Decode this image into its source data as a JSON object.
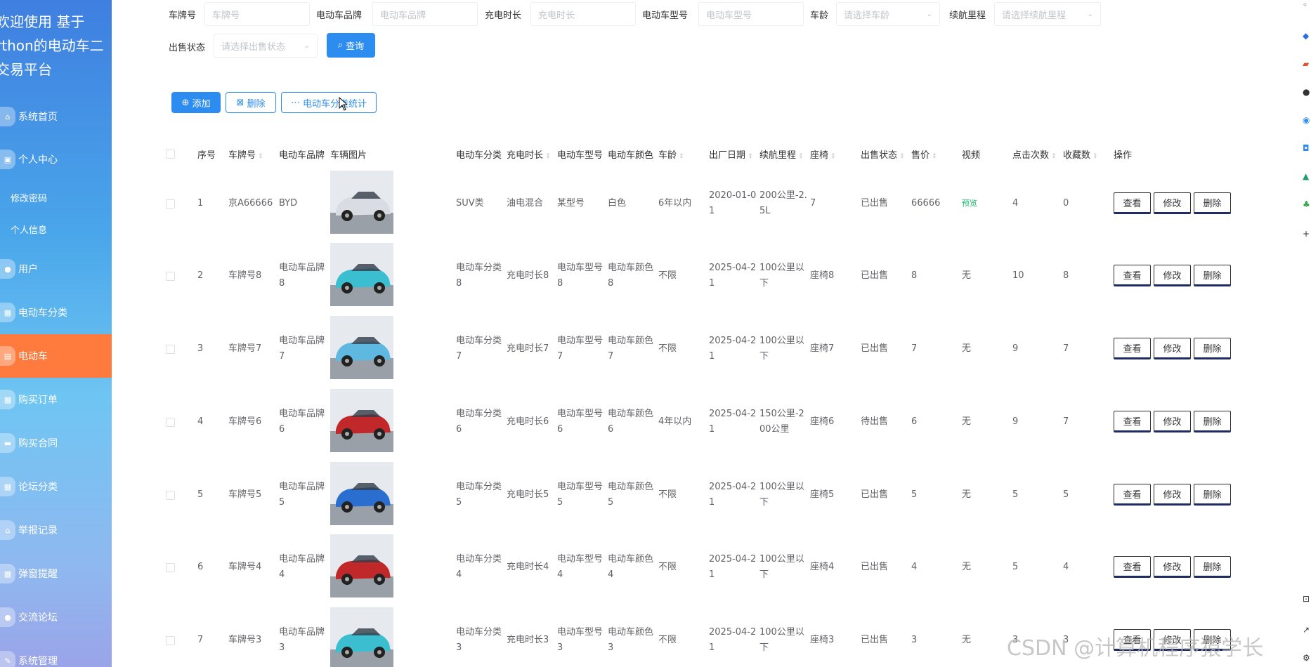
{
  "sidebar": {
    "brand_lines": [
      "欢迎使用 基于",
      "rthon的电动车二",
      "交易平台"
    ],
    "items": [
      {
        "label": "系统首页",
        "icon": "home-icon"
      },
      {
        "label": "个人中心",
        "icon": "user-center-icon"
      },
      {
        "label": "修改密码"
      },
      {
        "label": "个人信息"
      },
      {
        "label": "用户",
        "icon": "user-icon"
      },
      {
        "label": "电动车分类",
        "icon": "grid-icon"
      },
      {
        "label": "电动车",
        "icon": "car-icon"
      },
      {
        "label": "购买订单",
        "icon": "grid-icon"
      },
      {
        "label": "购买合同",
        "icon": "chat-icon"
      },
      {
        "label": "论坛分类",
        "icon": "grid-icon"
      },
      {
        "label": "举报记录",
        "icon": "home-icon"
      },
      {
        "label": "弹窗提醒",
        "icon": "grid-icon"
      },
      {
        "label": "交流论坛",
        "icon": "chat-icon"
      },
      {
        "label": "系统管理",
        "icon": "gear-icon"
      }
    ]
  },
  "filters": {
    "plate_label": "车牌号",
    "plate_placeholder": "车牌号",
    "brand_label": "电动车品牌",
    "brand_placeholder": "电动车品牌",
    "charge_label": "充电时长",
    "charge_placeholder": "充电时长",
    "model_label": "电动车型号",
    "model_placeholder": "电动车型号",
    "age_label": "车龄",
    "age_placeholder": "请选择车龄",
    "range_label": "续航里程",
    "range_placeholder": "请选择续航里程",
    "status_label": "出售状态",
    "status_placeholder": "请选择出售状态",
    "search_button": "查询"
  },
  "toolbar": {
    "add": "添加",
    "delete": "删除",
    "stats": "电动车分类统计"
  },
  "table": {
    "headers": [
      "序号",
      "车牌号",
      "电动车品牌",
      "车辆图片",
      "电动车分类",
      "充电时长",
      "电动车型号",
      "电动车颜色",
      "车龄",
      "出厂日期",
      "续航里程",
      "座椅",
      "出售状态",
      "售价",
      "视频",
      "点击次数",
      "收藏数",
      "操作"
    ],
    "actions": {
      "view": "查看",
      "edit": "修改",
      "delete": "删除"
    },
    "rows": [
      {
        "no": "1",
        "plate": "京A66666",
        "brand": "BYD",
        "category": "SUV类",
        "charge": "油电混合",
        "model": "某型号",
        "color": "白色",
        "age": "6年以内",
        "date": "2020-01-01",
        "range": "200公里-2.5L",
        "seat": "7",
        "status": "已出售",
        "price": "66666",
        "video": "预览",
        "clicks": "4",
        "favs": "0",
        "car_color": "#d9dde3"
      },
      {
        "no": "2",
        "plate": "车牌号8",
        "brand": "电动车品牌8",
        "category": "电动车分类8",
        "charge": "充电时长8",
        "model": "电动车型号8",
        "color": "电动车颜色8",
        "age": "不限",
        "date": "2025-04-21",
        "range": "100公里以下",
        "seat": "座椅8",
        "status": "已出售",
        "price": "8",
        "video": "无",
        "clicks": "10",
        "favs": "8",
        "car_color": "#3bbfd0"
      },
      {
        "no": "3",
        "plate": "车牌号7",
        "brand": "电动车品牌7",
        "category": "电动车分类7",
        "charge": "充电时长7",
        "model": "电动车型号7",
        "color": "电动车颜色7",
        "age": "不限",
        "date": "2025-04-21",
        "range": "100公里以下",
        "seat": "座椅7",
        "status": "已出售",
        "price": "7",
        "video": "无",
        "clicks": "9",
        "favs": "7",
        "car_color": "#5fb8e0"
      },
      {
        "no": "4",
        "plate": "车牌号6",
        "brand": "电动车品牌6",
        "category": "电动车分类6",
        "charge": "充电时长6",
        "model": "电动车型号6",
        "color": "电动车颜色6",
        "age": "4年以内",
        "date": "2025-04-21",
        "range": "150公里-200公里",
        "seat": "座椅6",
        "status": "待出售",
        "price": "6",
        "video": "无",
        "clicks": "9",
        "favs": "7",
        "car_color": "#c0282a"
      },
      {
        "no": "5",
        "plate": "车牌号5",
        "brand": "电动车品牌5",
        "category": "电动车分类5",
        "charge": "充电时长5",
        "model": "电动车型号5",
        "color": "电动车颜色5",
        "age": "不限",
        "date": "2025-04-21",
        "range": "100公里以下",
        "seat": "座椅5",
        "status": "已出售",
        "price": "5",
        "video": "无",
        "clicks": "5",
        "favs": "5",
        "car_color": "#2a6fd0"
      },
      {
        "no": "6",
        "plate": "车牌号4",
        "brand": "电动车品牌4",
        "category": "电动车分类4",
        "charge": "充电时长4",
        "model": "电动车型号4",
        "color": "电动车颜色4",
        "age": "不限",
        "date": "2025-04-21",
        "range": "100公里以下",
        "seat": "座椅4",
        "status": "已出售",
        "price": "4",
        "video": "无",
        "clicks": "5",
        "favs": "4",
        "car_color": "#c0282a"
      },
      {
        "no": "7",
        "plate": "车牌号3",
        "brand": "电动车品牌3",
        "category": "电动车分类3",
        "charge": "充电时长3",
        "model": "电动车型号3",
        "color": "电动车颜色3",
        "age": "不限",
        "date": "2025-04-21",
        "range": "100公里以下",
        "seat": "座椅3",
        "status": "已出售",
        "price": "3",
        "video": "无",
        "clicks": "3",
        "favs": "3",
        "car_color": "#3bbfd0"
      }
    ]
  },
  "watermark": "CSDN @计算机程序猿学长",
  "colors": {
    "primary": "#2d8cf0",
    "active_nav": "#ff7a3d",
    "preview_link": "#19be6b"
  }
}
